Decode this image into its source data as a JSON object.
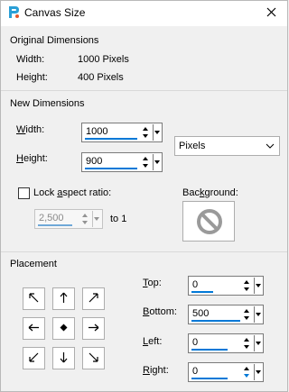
{
  "window": {
    "title": "Canvas Size",
    "close_label": "✕"
  },
  "original": {
    "section_label": "Original Dimensions",
    "width_label": "Width:",
    "width_value": "1000 Pixels",
    "height_label": "Height:",
    "height_value": "400 Pixels"
  },
  "new_dims": {
    "section_label": "New Dimensions",
    "width_label_u": "W",
    "width_label_rest": "idth:",
    "width_value": "1000",
    "height_label_u": "H",
    "height_label_rest": "eight:",
    "height_value": "900",
    "units_value": "Pixels",
    "lock_label_pre": "Lock ",
    "lock_label_u": "a",
    "lock_label_post": "spect ratio:",
    "lock_checked": false,
    "ratio_value": "2,500",
    "ratio_suffix": "to 1",
    "background_label_pre": "Bac",
    "background_label_u": "k",
    "background_label_post": "ground:",
    "background_icon": "no-fill-icon"
  },
  "placement": {
    "section_label": "Placement",
    "buttons": [
      "arrow-up-left-icon",
      "arrow-up-icon",
      "arrow-up-right-icon",
      "arrow-left-icon",
      "center-dot-icon",
      "arrow-right-icon",
      "arrow-down-left-icon",
      "arrow-down-icon",
      "arrow-down-right-icon"
    ],
    "top_label_u": "T",
    "top_label_rest": "op:",
    "top_value": "0",
    "bottom_label_u": "B",
    "bottom_label_rest": "ottom:",
    "bottom_value": "500",
    "left_label_u": "L",
    "left_label_rest": "eft:",
    "left_value": "0",
    "right_label_u": "R",
    "right_label_rest": "ight:",
    "right_value": "0"
  },
  "colors": {
    "accent": "#0078d7",
    "disabled": "#8a8a8a"
  }
}
